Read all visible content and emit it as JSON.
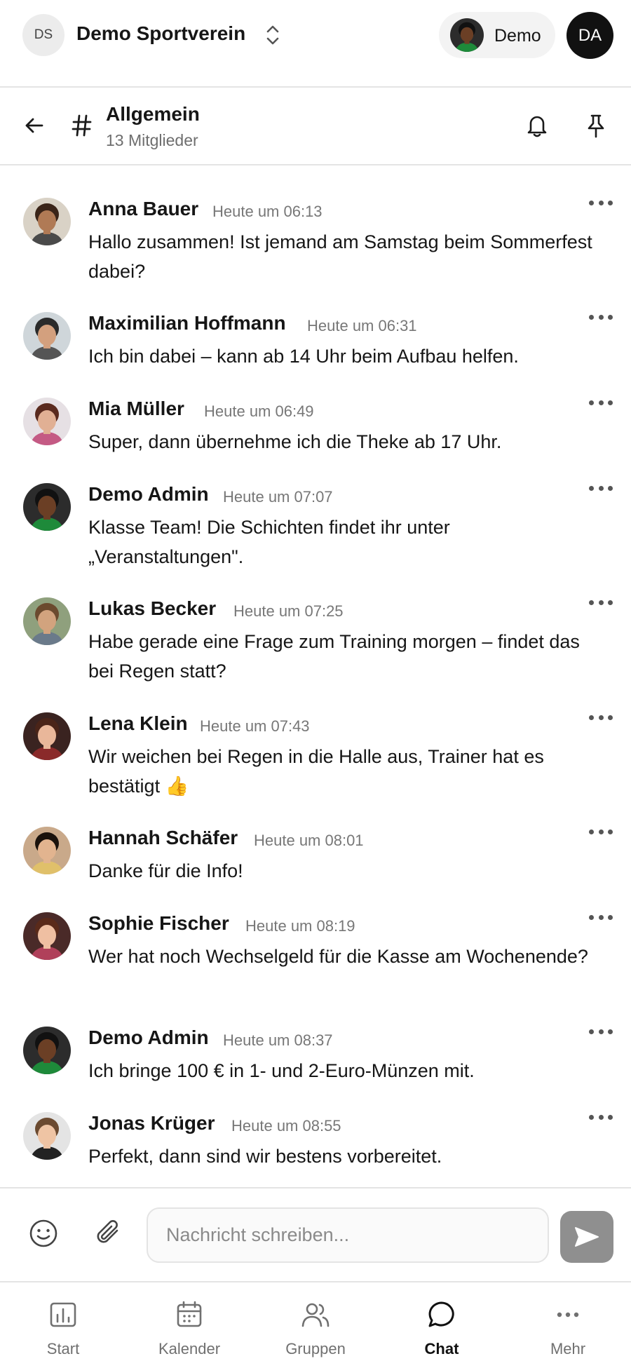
{
  "header": {
    "org_initials": "DS",
    "org_name": "Demo Sportverein",
    "user_pill_name": "Demo",
    "my_initials": "DA"
  },
  "channel": {
    "title": "Allgemein",
    "members": "13 Mitglieder"
  },
  "messages": [
    {
      "author": "Anna Bauer",
      "time": "Heute um 06:13",
      "text": "Hallo zusammen! Ist jemand am Samstag beim Sommerfest dabei?"
    },
    {
      "author": "Maximilian Hoffmann",
      "time": "Heute um 06:31",
      "text": "Ich bin dabei – kann ab 14 Uhr beim Aufbau helfen."
    },
    {
      "author": "Mia Müller",
      "time": "Heute um 06:49",
      "text": "Super, dann übernehme ich die Theke ab 17 Uhr."
    },
    {
      "author": "Demo Admin",
      "time": "Heute um 07:07",
      "text": "Klasse Team! Die Schichten findet ihr unter „Veranstaltungen\"."
    },
    {
      "author": "Lukas Becker",
      "time": "Heute um 07:25",
      "text": "Habe gerade eine Frage zum Training morgen – findet das bei Regen statt?"
    },
    {
      "author": "Lena Klein",
      "time": "Heute um 07:43",
      "text": "Wir weichen bei Regen in die Halle aus, Trainer hat es bestätigt 👍"
    },
    {
      "author": "Hannah Schäfer",
      "time": "Heute um 08:01",
      "text": "Danke für die Info!"
    },
    {
      "author": "Sophie Fischer",
      "time": "Heute um 08:19",
      "text": "Wer hat noch Wechselgeld für die Kasse am Wochenende?"
    },
    {
      "author": "Demo Admin",
      "time": "Heute um 08:37",
      "text": "Ich bringe 100 € in 1- und 2-Euro-Münzen mit."
    },
    {
      "author": "Jonas Krüger",
      "time": "Heute um 08:55",
      "text": "Perfekt, dann sind wir bestens vorbereitet."
    }
  ],
  "composer": {
    "placeholder": "Nachricht schreiben..."
  },
  "nav": {
    "items": [
      {
        "label": "Start",
        "icon": "dashboard-icon",
        "active": false
      },
      {
        "label": "Kalender",
        "icon": "calendar-icon",
        "active": false
      },
      {
        "label": "Gruppen",
        "icon": "users-icon",
        "active": false
      },
      {
        "label": "Chat",
        "icon": "chat-bubble-icon",
        "active": true
      },
      {
        "label": "Mehr",
        "icon": "more-dots-icon",
        "active": false
      }
    ]
  },
  "colors": {
    "text": "#161616",
    "muted": "#777777",
    "divider": "#e4e4e4",
    "send_button": "#8f8f8f",
    "active_nav": "#111111"
  }
}
